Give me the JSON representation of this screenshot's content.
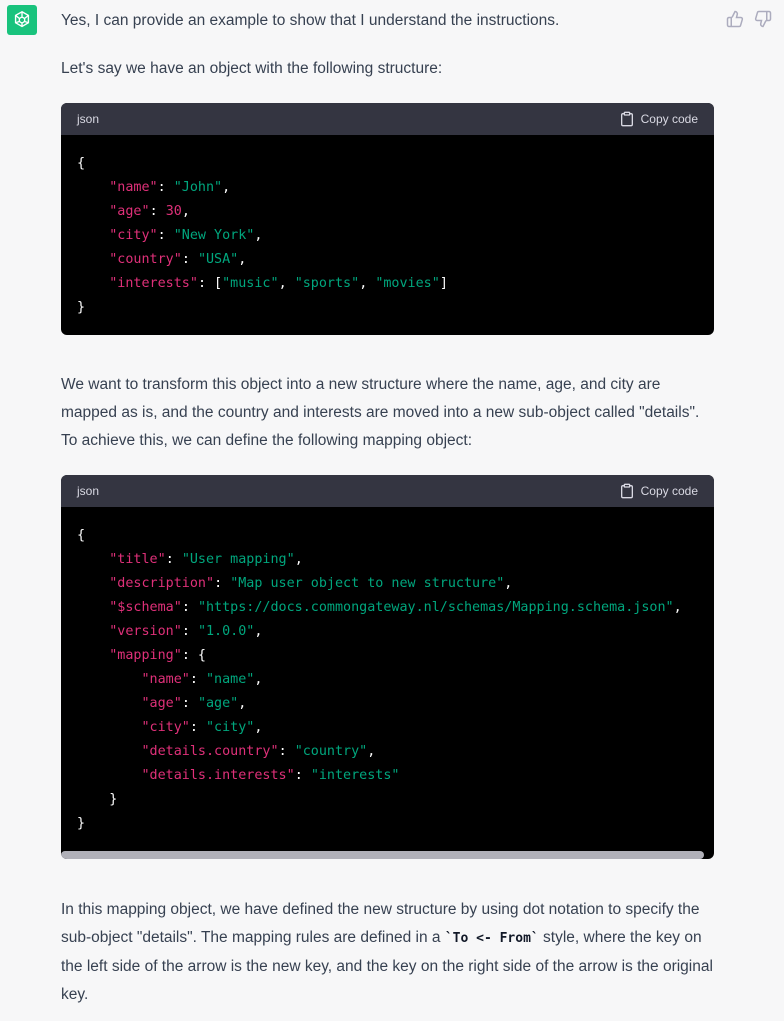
{
  "message": {
    "intro": "Yes, I can provide an example to show that I understand the instructions.",
    "lead": "Let's say we have an object with the following structure:",
    "para_mid": "We want to transform this object into a new structure where the name, age, and city are mapped as is, and the country and interests are moved into a new sub-object called \"details\". To achieve this, we can define the following mapping object:",
    "para_end_before": "In this mapping object, we have defined the new structure by using dot notation to specify the sub-object \"details\". The mapping rules are defined in a ",
    "para_end_code": "`To <- From`",
    "para_end_after": " style, where the key on the left side of the arrow is the new key, and the key on the right side of the arrow is the original key."
  },
  "code_blocks": [
    {
      "language": "json",
      "copy_label": "Copy code"
    },
    {
      "language": "json",
      "copy_label": "Copy code"
    }
  ],
  "colors": {
    "accent": "#19c37d",
    "code_key": "#df3079",
    "code_string": "#00a67d",
    "header_bg": "#343541"
  },
  "icons": {
    "avatar": "openai-logo-icon",
    "like": "thumbs-up-icon",
    "dislike": "thumbs-down-icon",
    "copy": "clipboard-icon"
  }
}
